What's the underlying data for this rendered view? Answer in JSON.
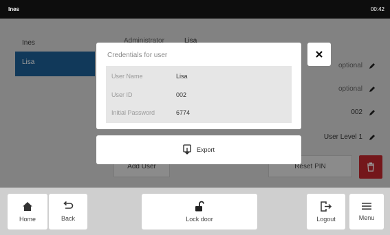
{
  "statusbar": {
    "user": "Ines",
    "time": "00:42"
  },
  "users": [
    {
      "name": "Ines"
    },
    {
      "name": "Lisa"
    }
  ],
  "details": {
    "role_label": "Administrator",
    "name_value": "Lisa",
    "optional_1": "optional",
    "optional_2": "optional",
    "id_value": "002",
    "level_value": "User Level 1"
  },
  "under_buttons": {
    "add_user": "Add User",
    "reset_pin": "Reset PIN"
  },
  "modal": {
    "title": "Credentials for user",
    "rows": [
      {
        "label": "User Name",
        "value": "Lisa"
      },
      {
        "label": "User ID",
        "value": "002"
      },
      {
        "label": "Initial Password",
        "value": "6774"
      }
    ]
  },
  "export": {
    "label": "Export"
  },
  "bottom": {
    "home": "Home",
    "back": "Back",
    "lock": "Lock door",
    "logout": "Logout",
    "menu": "Menu"
  },
  "colors": {
    "accent": "#1d5f96",
    "danger": "#c2272d",
    "statusbar": "#0d0d0d"
  }
}
